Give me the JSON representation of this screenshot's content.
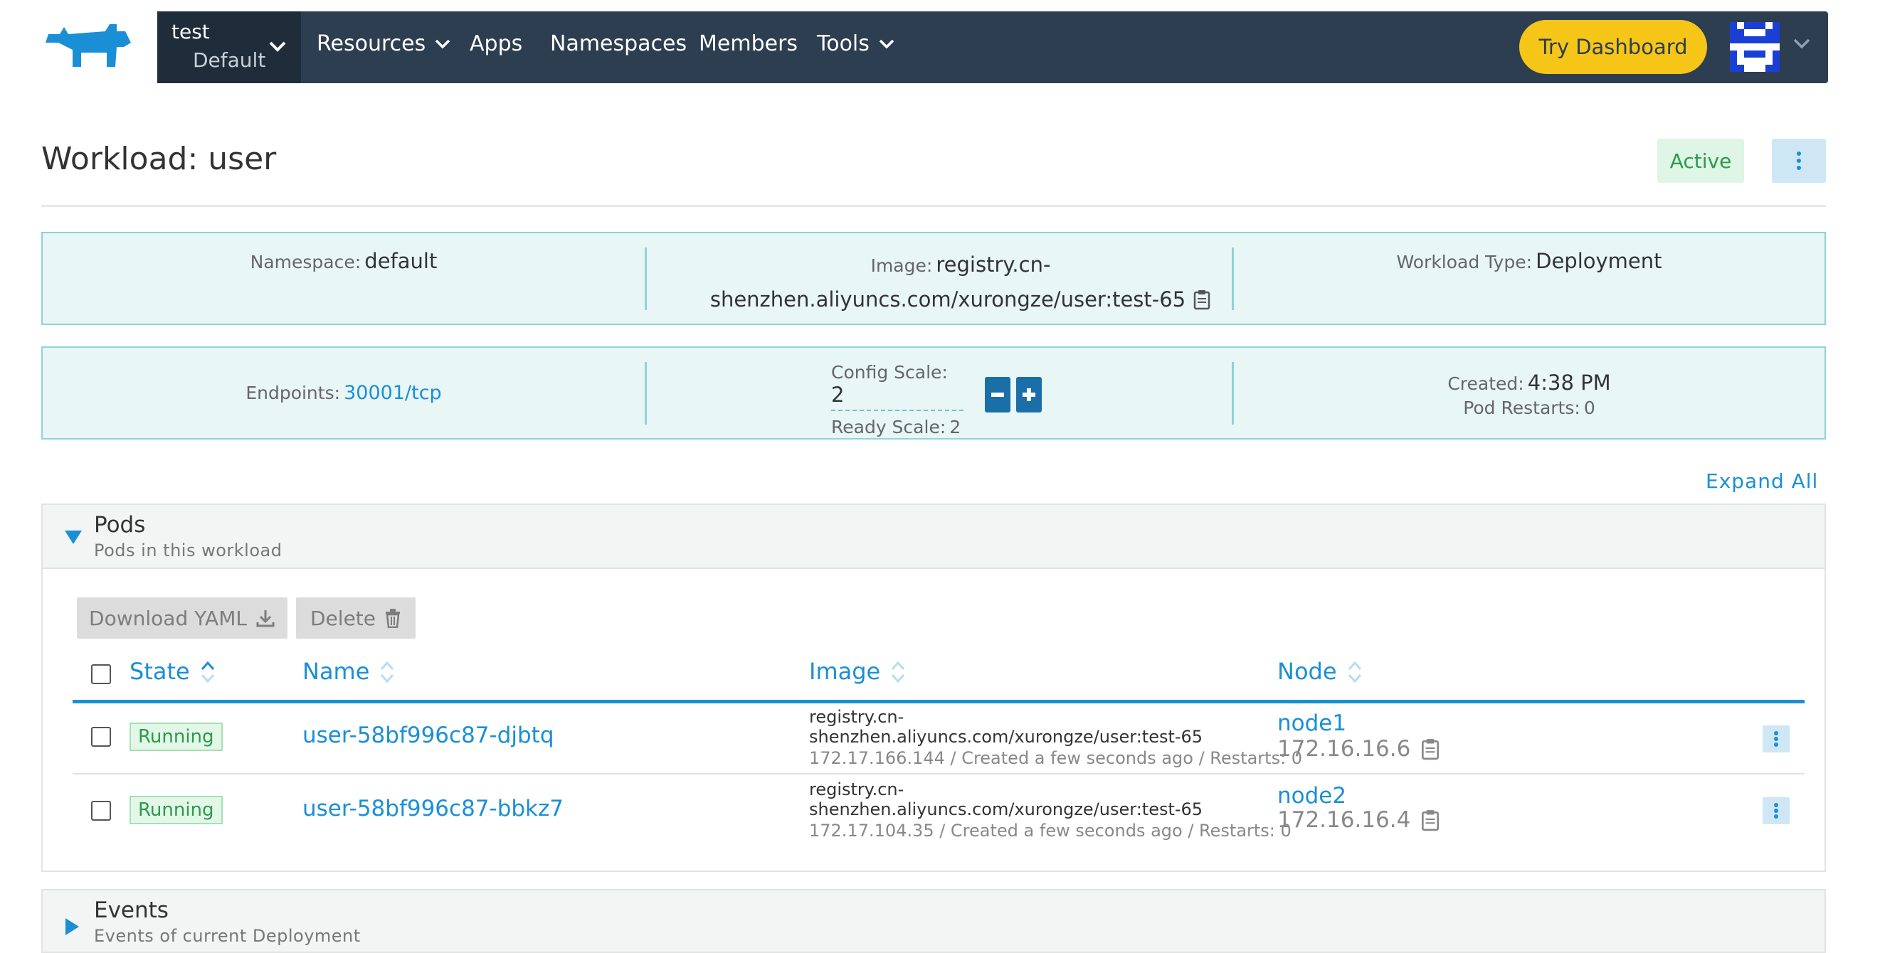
{
  "nav": {
    "cluster": "test",
    "project": "Default",
    "items": [
      {
        "label": "Resources",
        "has_dropdown": true
      },
      {
        "label": "Apps",
        "has_dropdown": false
      },
      {
        "label": "Namespaces",
        "has_dropdown": false
      },
      {
        "label": "Members",
        "has_dropdown": false
      },
      {
        "label": "Tools",
        "has_dropdown": true
      }
    ],
    "try_dashboard": "Try Dashboard"
  },
  "header": {
    "title": "Workload: user",
    "status": "Active"
  },
  "info": {
    "namespace_label": "Namespace:",
    "namespace_value": "default",
    "image_label": "Image:",
    "image_value_line1": "registry.cn-",
    "image_value_line2": "shenzhen.aliyuncs.com/xurongze/user:test-65",
    "workload_type_label": "Workload Type:",
    "workload_type_value": "Deployment",
    "endpoints_label": "Endpoints:",
    "endpoints_value": "30001/tcp",
    "config_scale_label": "Config Scale:",
    "config_scale_value": "2",
    "ready_scale_label": "Ready Scale:",
    "ready_scale_value": "2",
    "created_label": "Created:",
    "created_value": "4:38 PM",
    "pod_restarts_label": "Pod Restarts:",
    "pod_restarts_value": "0"
  },
  "expand_all": "Expand All",
  "pods": {
    "title": "Pods",
    "subtitle": "Pods in this workload",
    "download_yaml": "Download YAML",
    "delete": "Delete",
    "columns": [
      "State",
      "Name",
      "Image",
      "Node"
    ],
    "rows": [
      {
        "state": "Running",
        "name": "user-58bf996c87-djbtq",
        "image": "registry.cn-shenzhen.aliyuncs.com/xurongze/user:test-65",
        "details": "172.17.166.144 / Created a few seconds ago / Restarts: 0",
        "node": "node1",
        "node_ip": "172.16.16.6"
      },
      {
        "state": "Running",
        "name": "user-58bf996c87-bbkz7",
        "image": "registry.cn-shenzhen.aliyuncs.com/xurongze/user:test-65",
        "details": "172.17.104.35 / Created a few seconds ago / Restarts: 0",
        "node": "node2",
        "node_ip": "172.16.16.4"
      }
    ]
  },
  "events": {
    "title": "Events",
    "subtitle": "Events of current Deployment"
  },
  "icons": {
    "logo": "rancher-logo-icon",
    "copy": "clipboard-icon",
    "download": "download-icon",
    "trash": "trash-icon",
    "menu": "vertical-dots-icon",
    "sort": "sort-icon"
  },
  "colors": {
    "navbar": "#2c3e50",
    "brand_blue": "#1a8fd6",
    "accent_yellow": "#f5c518",
    "active_green": "#2d9a4c",
    "info_bg": "#e8f6f6"
  }
}
